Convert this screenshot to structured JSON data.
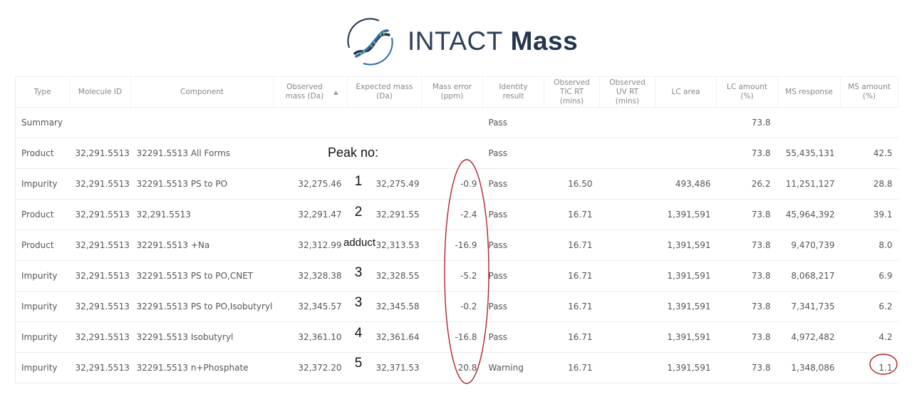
{
  "logo": {
    "light_text": "INTACT",
    "bold_text": "Mass",
    "icon": "dna-helix-icon"
  },
  "table": {
    "columns": [
      {
        "key": "type",
        "label": "Type"
      },
      {
        "key": "molecule_id",
        "label": "Molecule ID"
      },
      {
        "key": "component",
        "label": "Component"
      },
      {
        "key": "observed_mass",
        "label": "Observed mass (Da)",
        "sorted": "ascending"
      },
      {
        "key": "expected_mass",
        "label": "Expected mass (Da)"
      },
      {
        "key": "mass_error",
        "label": "Mass error (ppm)"
      },
      {
        "key": "identity_result",
        "label": "Identity result"
      },
      {
        "key": "tic_rt",
        "label": "Observed TIC RT (mins)"
      },
      {
        "key": "uv_rt",
        "label": "Observed UV RT (mins)"
      },
      {
        "key": "lc_area",
        "label": "LC area"
      },
      {
        "key": "lc_amount",
        "label": "LC amount (%)"
      },
      {
        "key": "ms_response",
        "label": "MS response"
      },
      {
        "key": "ms_amount",
        "label": "MS amount (%)"
      }
    ],
    "rows": [
      {
        "type": "Summary",
        "molecule_id": "",
        "component": "",
        "observed_mass": "",
        "expected_mass": "",
        "mass_error": "",
        "identity_result": "Pass",
        "tic_rt": "",
        "uv_rt": "",
        "lc_area": "",
        "lc_amount": "73.8",
        "ms_response": "",
        "ms_amount": ""
      },
      {
        "type": "Product",
        "molecule_id": "32,291.5513",
        "component": "32291.5513 All Forms",
        "observed_mass": "",
        "expected_mass": "",
        "mass_error": "",
        "identity_result": "Pass",
        "tic_rt": "",
        "uv_rt": "",
        "lc_area": "",
        "lc_amount": "73.8",
        "ms_response": "55,435,131",
        "ms_amount": "42.5"
      },
      {
        "type": "Impurity",
        "molecule_id": "32,291.5513",
        "component": "32291.5513 PS to PO",
        "observed_mass": "32,275.46",
        "expected_mass": "32,275.49",
        "mass_error": "-0.9",
        "identity_result": "Pass",
        "tic_rt": "16.50",
        "uv_rt": "",
        "lc_area": "493,486",
        "lc_amount": "26.2",
        "ms_response": "11,251,127",
        "ms_amount": "28.8"
      },
      {
        "type": "Product",
        "molecule_id": "32,291.5513",
        "component": "32,291.5513",
        "observed_mass": "32,291.47",
        "expected_mass": "32,291.55",
        "mass_error": "-2.4",
        "identity_result": "Pass",
        "tic_rt": "16.71",
        "uv_rt": "",
        "lc_area": "1,391,591",
        "lc_amount": "73.8",
        "ms_response": "45,964,392",
        "ms_amount": "39.1"
      },
      {
        "type": "Product",
        "molecule_id": "32,291.5513",
        "component": "32291.5513 +Na",
        "observed_mass": "32,312.99",
        "expected_mass": "32,313.53",
        "mass_error": "-16.9",
        "identity_result": "Pass",
        "tic_rt": "16.71",
        "uv_rt": "",
        "lc_area": "1,391,591",
        "lc_amount": "73.8",
        "ms_response": "9,470,739",
        "ms_amount": "8.0"
      },
      {
        "type": "Impurity",
        "molecule_id": "32,291.5513",
        "component": "32291.5513 PS to PO,CNET",
        "observed_mass": "32,328.38",
        "expected_mass": "32,328.55",
        "mass_error": "-5.2",
        "identity_result": "Pass",
        "tic_rt": "16.71",
        "uv_rt": "",
        "lc_area": "1,391,591",
        "lc_amount": "73.8",
        "ms_response": "8,068,217",
        "ms_amount": "6.9"
      },
      {
        "type": "Impurity",
        "molecule_id": "32,291.5513",
        "component": "32291.5513 PS to PO,Isobutyryl",
        "observed_mass": "32,345.57",
        "expected_mass": "32,345.58",
        "mass_error": "-0.2",
        "identity_result": "Pass",
        "tic_rt": "16.71",
        "uv_rt": "",
        "lc_area": "1,391,591",
        "lc_amount": "73.8",
        "ms_response": "7,341,735",
        "ms_amount": "6.2"
      },
      {
        "type": "Impurity",
        "molecule_id": "32,291.5513",
        "component": "32291.5513 Isobutyryl",
        "observed_mass": "32,361.10",
        "expected_mass": "32,361.64",
        "mass_error": "-16.8",
        "identity_result": "Pass",
        "tic_rt": "16.71",
        "uv_rt": "",
        "lc_area": "1,391,591",
        "lc_amount": "73.8",
        "ms_response": "4,972,482",
        "ms_amount": "4.2"
      },
      {
        "type": "Impurity",
        "molecule_id": "32,291.5513",
        "component": "32291.5513 n+Phosphate",
        "observed_mass": "32,372.20",
        "expected_mass": "32,371.53",
        "mass_error": "20.8",
        "identity_result": "Warning",
        "tic_rt": "16.71",
        "uv_rt": "",
        "lc_area": "1,391,591",
        "lc_amount": "73.8",
        "ms_response": "1,348,086",
        "ms_amount": "1.1"
      }
    ]
  },
  "annotations": {
    "peak_title": "Peak no:",
    "peak_labels": [
      "",
      "",
      "1",
      "2",
      "adduct",
      "3",
      "3",
      "4",
      "5"
    ],
    "highlight_color": "#b0222a",
    "highlighted_column": "Mass error (ppm)",
    "highlighted_cell": "1.1"
  }
}
